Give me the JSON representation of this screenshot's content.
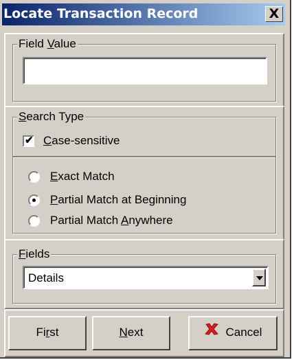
{
  "window": {
    "title": "Locate Transaction Record",
    "close_glyph": "X"
  },
  "field_value": {
    "legend": "Field Value",
    "legend_access": "V",
    "value": ""
  },
  "search_type": {
    "legend": "Search Type",
    "case_sensitive": {
      "label": "Case-sensitive",
      "checked": true
    },
    "options": [
      {
        "label": "Exact Match",
        "selected": false
      },
      {
        "label": "Partial Match at Beginning",
        "selected": true
      },
      {
        "label": "Partial Match Anywhere",
        "selected": false
      }
    ]
  },
  "fields": {
    "legend": "Fields",
    "selected": "Details"
  },
  "buttons": {
    "first": "First",
    "next": "Next",
    "cancel": "Cancel",
    "cancel_icon": "red-x-icon"
  }
}
